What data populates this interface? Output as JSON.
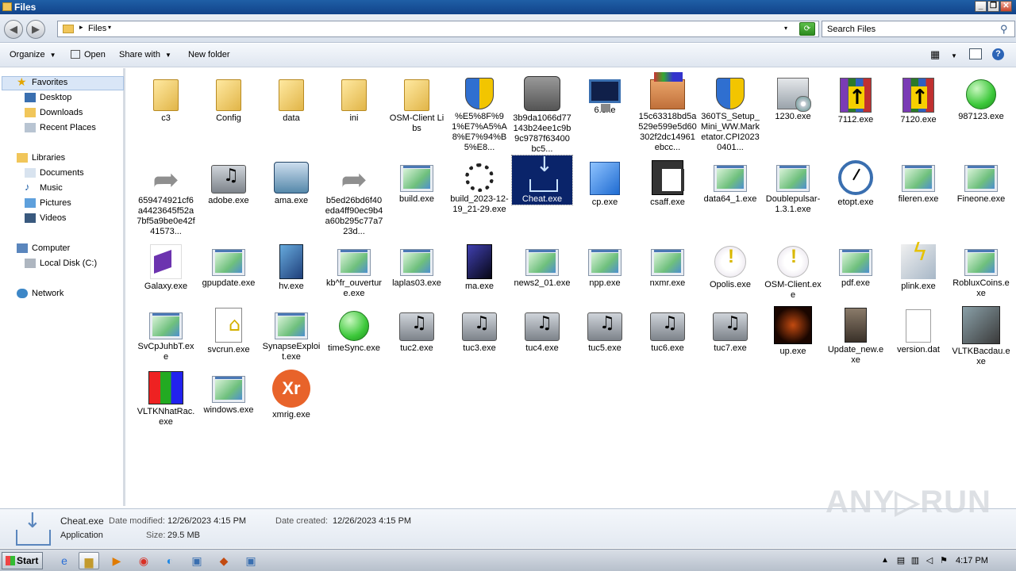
{
  "window": {
    "title": "Files",
    "btn_min": "_",
    "btn_restore": "❐",
    "btn_close": "✕"
  },
  "address": {
    "crumb": "Files",
    "search_placeholder": "Search Files",
    "back": "◀",
    "forward": "▶",
    "refresh": "⟳",
    "dropdown": "▾",
    "crumb_arrow": "▸"
  },
  "toolbar": {
    "organize": "Organize",
    "open": "Open",
    "share_with": "Share with",
    "new_folder": "New folder"
  },
  "sidebar": {
    "favorites": "Favorites",
    "desktop": "Desktop",
    "downloads": "Downloads",
    "recent": "Recent Places",
    "libraries": "Libraries",
    "documents": "Documents",
    "music": "Music",
    "pictures": "Pictures",
    "videos": "Videos",
    "computer": "Computer",
    "local_disk": "Local Disk (C:)",
    "network": "Network"
  },
  "files": [
    {
      "label": "c3",
      "icon": "folder"
    },
    {
      "label": "Config",
      "icon": "folder"
    },
    {
      "label": "data",
      "icon": "folder"
    },
    {
      "label": "ini",
      "icon": "folder"
    },
    {
      "label": "OSM-Client Libs",
      "icon": "folder"
    },
    {
      "label": "%E5%8F%91%E7%A5%A8%E7%94%B5%E8...",
      "icon": "shield-folder"
    },
    {
      "label": "3b9da1066d77143b24ee1c9b9c9787f63400bc5...",
      "icon": "blurred-exe"
    },
    {
      "label": "6.exe",
      "icon": "monitor"
    },
    {
      "label": "15c63318bd5a529e599e5d60302f2dc14961ebcc...",
      "icon": "package"
    },
    {
      "label": "360TS_Setup_Mini_WW.Marketator.CPI20230401...",
      "icon": "setup-shield"
    },
    {
      "label": "1230.exe",
      "icon": "cdrom"
    },
    {
      "label": "7112.exe",
      "icon": "winrar"
    },
    {
      "label": "7120.exe",
      "icon": "winrar"
    },
    {
      "label": "987123.exe",
      "icon": "green-orb"
    },
    {
      "label": "659474921cf6a4423645f52a7bf5a9be0e42f41573...",
      "icon": "shortcut-arrow"
    },
    {
      "label": "adobe.exe",
      "icon": "speaker"
    },
    {
      "label": "ama.exe",
      "icon": "network"
    },
    {
      "label": "b5ed26bd6f40eda4ff90ec9b4a60b295c77a723d...",
      "icon": "shortcut-arrow"
    },
    {
      "label": "build.exe",
      "icon": "exe"
    },
    {
      "label": "build_2023-12-19_21-29.exe",
      "icon": "spinner"
    },
    {
      "label": "Cheat.exe",
      "icon": "download",
      "selected": true
    },
    {
      "label": "cp.exe",
      "icon": "cube"
    },
    {
      "label": "csaff.exe",
      "icon": "gift"
    },
    {
      "label": "data64_1.exe",
      "icon": "exe"
    },
    {
      "label": "Doublepulsar-1.3.1.exe",
      "icon": "exe"
    },
    {
      "label": "etopt.exe",
      "icon": "clock"
    },
    {
      "label": "fileren.exe",
      "icon": "exe"
    },
    {
      "label": "Fineone.exe",
      "icon": "exe"
    },
    {
      "label": "Galaxy.exe",
      "icon": "visual-studio"
    },
    {
      "label": "gpupdate.exe",
      "icon": "exe"
    },
    {
      "label": "hv.exe",
      "icon": "tall-box"
    },
    {
      "label": "kb^fr_ouverture.exe",
      "icon": "exe"
    },
    {
      "label": "laplas03.exe",
      "icon": "exe"
    },
    {
      "label": "ma.exe",
      "icon": "dark-box"
    },
    {
      "label": "news2_01.exe",
      "icon": "exe"
    },
    {
      "label": "npp.exe",
      "icon": "exe"
    },
    {
      "label": "nxmr.exe",
      "icon": "exe"
    },
    {
      "label": "Opolis.exe",
      "icon": "warning"
    },
    {
      "label": "OSM-Client.exe",
      "icon": "warning"
    },
    {
      "label": "pdf.exe",
      "icon": "exe"
    },
    {
      "label": "plink.exe",
      "icon": "plink"
    },
    {
      "label": "RobluxCoins.exe",
      "icon": "exe"
    },
    {
      "label": "SvCpJuhbT.exe",
      "icon": "exe"
    },
    {
      "label": "svcrun.exe",
      "icon": "svcrun"
    },
    {
      "label": "SynapseExploit.exe",
      "icon": "exe"
    },
    {
      "label": "timeSync.exe",
      "icon": "green-orb"
    },
    {
      "label": "tuc2.exe",
      "icon": "speaker"
    },
    {
      "label": "tuc3.exe",
      "icon": "speaker"
    },
    {
      "label": "tuc4.exe",
      "icon": "speaker"
    },
    {
      "label": "tuc5.exe",
      "icon": "speaker"
    },
    {
      "label": "tuc6.exe",
      "icon": "speaker"
    },
    {
      "label": "tuc7.exe",
      "icon": "speaker"
    },
    {
      "label": "up.exe",
      "icon": "up"
    },
    {
      "label": "Update_new.exe",
      "icon": "update"
    },
    {
      "label": "version.dat",
      "icon": "document"
    },
    {
      "label": "VLTKBacdau.exe",
      "icon": "vltk"
    },
    {
      "label": "VLTKNhatRac.exe",
      "icon": "vltkn"
    },
    {
      "label": "windows.exe",
      "icon": "exe"
    },
    {
      "label": "xmrig.exe",
      "icon": "xmrig"
    }
  ],
  "details": {
    "name": "Cheat.exe",
    "type": "Application",
    "modified_label": "Date modified:",
    "modified": "12/26/2023 4:15 PM",
    "created_label": "Date created:",
    "created": "12/26/2023 4:15 PM",
    "size_label": "Size:",
    "size": "29.5 MB"
  },
  "taskbar": {
    "start": "Start",
    "clock": "4:17 PM"
  },
  "watermark": "ANY▷RUN"
}
